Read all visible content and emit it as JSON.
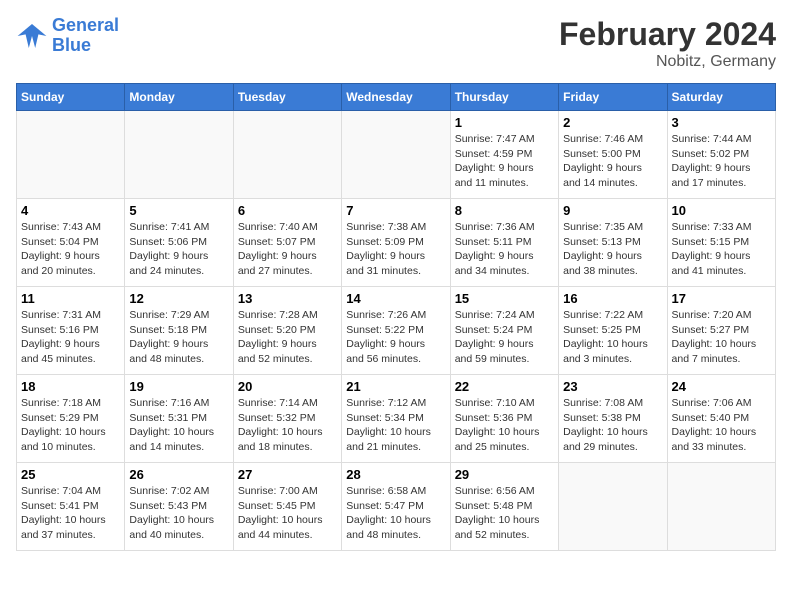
{
  "header": {
    "logo_line1": "General",
    "logo_line2": "Blue",
    "title": "February 2024",
    "subtitle": "Nobitz, Germany"
  },
  "weekdays": [
    "Sunday",
    "Monday",
    "Tuesday",
    "Wednesday",
    "Thursday",
    "Friday",
    "Saturday"
  ],
  "weeks": [
    [
      {
        "day": "",
        "info": ""
      },
      {
        "day": "",
        "info": ""
      },
      {
        "day": "",
        "info": ""
      },
      {
        "day": "",
        "info": ""
      },
      {
        "day": "1",
        "info": "Sunrise: 7:47 AM\nSunset: 4:59 PM\nDaylight: 9 hours\nand 11 minutes."
      },
      {
        "day": "2",
        "info": "Sunrise: 7:46 AM\nSunset: 5:00 PM\nDaylight: 9 hours\nand 14 minutes."
      },
      {
        "day": "3",
        "info": "Sunrise: 7:44 AM\nSunset: 5:02 PM\nDaylight: 9 hours\nand 17 minutes."
      }
    ],
    [
      {
        "day": "4",
        "info": "Sunrise: 7:43 AM\nSunset: 5:04 PM\nDaylight: 9 hours\nand 20 minutes."
      },
      {
        "day": "5",
        "info": "Sunrise: 7:41 AM\nSunset: 5:06 PM\nDaylight: 9 hours\nand 24 minutes."
      },
      {
        "day": "6",
        "info": "Sunrise: 7:40 AM\nSunset: 5:07 PM\nDaylight: 9 hours\nand 27 minutes."
      },
      {
        "day": "7",
        "info": "Sunrise: 7:38 AM\nSunset: 5:09 PM\nDaylight: 9 hours\nand 31 minutes."
      },
      {
        "day": "8",
        "info": "Sunrise: 7:36 AM\nSunset: 5:11 PM\nDaylight: 9 hours\nand 34 minutes."
      },
      {
        "day": "9",
        "info": "Sunrise: 7:35 AM\nSunset: 5:13 PM\nDaylight: 9 hours\nand 38 minutes."
      },
      {
        "day": "10",
        "info": "Sunrise: 7:33 AM\nSunset: 5:15 PM\nDaylight: 9 hours\nand 41 minutes."
      }
    ],
    [
      {
        "day": "11",
        "info": "Sunrise: 7:31 AM\nSunset: 5:16 PM\nDaylight: 9 hours\nand 45 minutes."
      },
      {
        "day": "12",
        "info": "Sunrise: 7:29 AM\nSunset: 5:18 PM\nDaylight: 9 hours\nand 48 minutes."
      },
      {
        "day": "13",
        "info": "Sunrise: 7:28 AM\nSunset: 5:20 PM\nDaylight: 9 hours\nand 52 minutes."
      },
      {
        "day": "14",
        "info": "Sunrise: 7:26 AM\nSunset: 5:22 PM\nDaylight: 9 hours\nand 56 minutes."
      },
      {
        "day": "15",
        "info": "Sunrise: 7:24 AM\nSunset: 5:24 PM\nDaylight: 9 hours\nand 59 minutes."
      },
      {
        "day": "16",
        "info": "Sunrise: 7:22 AM\nSunset: 5:25 PM\nDaylight: 10 hours\nand 3 minutes."
      },
      {
        "day": "17",
        "info": "Sunrise: 7:20 AM\nSunset: 5:27 PM\nDaylight: 10 hours\nand 7 minutes."
      }
    ],
    [
      {
        "day": "18",
        "info": "Sunrise: 7:18 AM\nSunset: 5:29 PM\nDaylight: 10 hours\nand 10 minutes."
      },
      {
        "day": "19",
        "info": "Sunrise: 7:16 AM\nSunset: 5:31 PM\nDaylight: 10 hours\nand 14 minutes."
      },
      {
        "day": "20",
        "info": "Sunrise: 7:14 AM\nSunset: 5:32 PM\nDaylight: 10 hours\nand 18 minutes."
      },
      {
        "day": "21",
        "info": "Sunrise: 7:12 AM\nSunset: 5:34 PM\nDaylight: 10 hours\nand 21 minutes."
      },
      {
        "day": "22",
        "info": "Sunrise: 7:10 AM\nSunset: 5:36 PM\nDaylight: 10 hours\nand 25 minutes."
      },
      {
        "day": "23",
        "info": "Sunrise: 7:08 AM\nSunset: 5:38 PM\nDaylight: 10 hours\nand 29 minutes."
      },
      {
        "day": "24",
        "info": "Sunrise: 7:06 AM\nSunset: 5:40 PM\nDaylight: 10 hours\nand 33 minutes."
      }
    ],
    [
      {
        "day": "25",
        "info": "Sunrise: 7:04 AM\nSunset: 5:41 PM\nDaylight: 10 hours\nand 37 minutes."
      },
      {
        "day": "26",
        "info": "Sunrise: 7:02 AM\nSunset: 5:43 PM\nDaylight: 10 hours\nand 40 minutes."
      },
      {
        "day": "27",
        "info": "Sunrise: 7:00 AM\nSunset: 5:45 PM\nDaylight: 10 hours\nand 44 minutes."
      },
      {
        "day": "28",
        "info": "Sunrise: 6:58 AM\nSunset: 5:47 PM\nDaylight: 10 hours\nand 48 minutes."
      },
      {
        "day": "29",
        "info": "Sunrise: 6:56 AM\nSunset: 5:48 PM\nDaylight: 10 hours\nand 52 minutes."
      },
      {
        "day": "",
        "info": ""
      },
      {
        "day": "",
        "info": ""
      }
    ]
  ]
}
